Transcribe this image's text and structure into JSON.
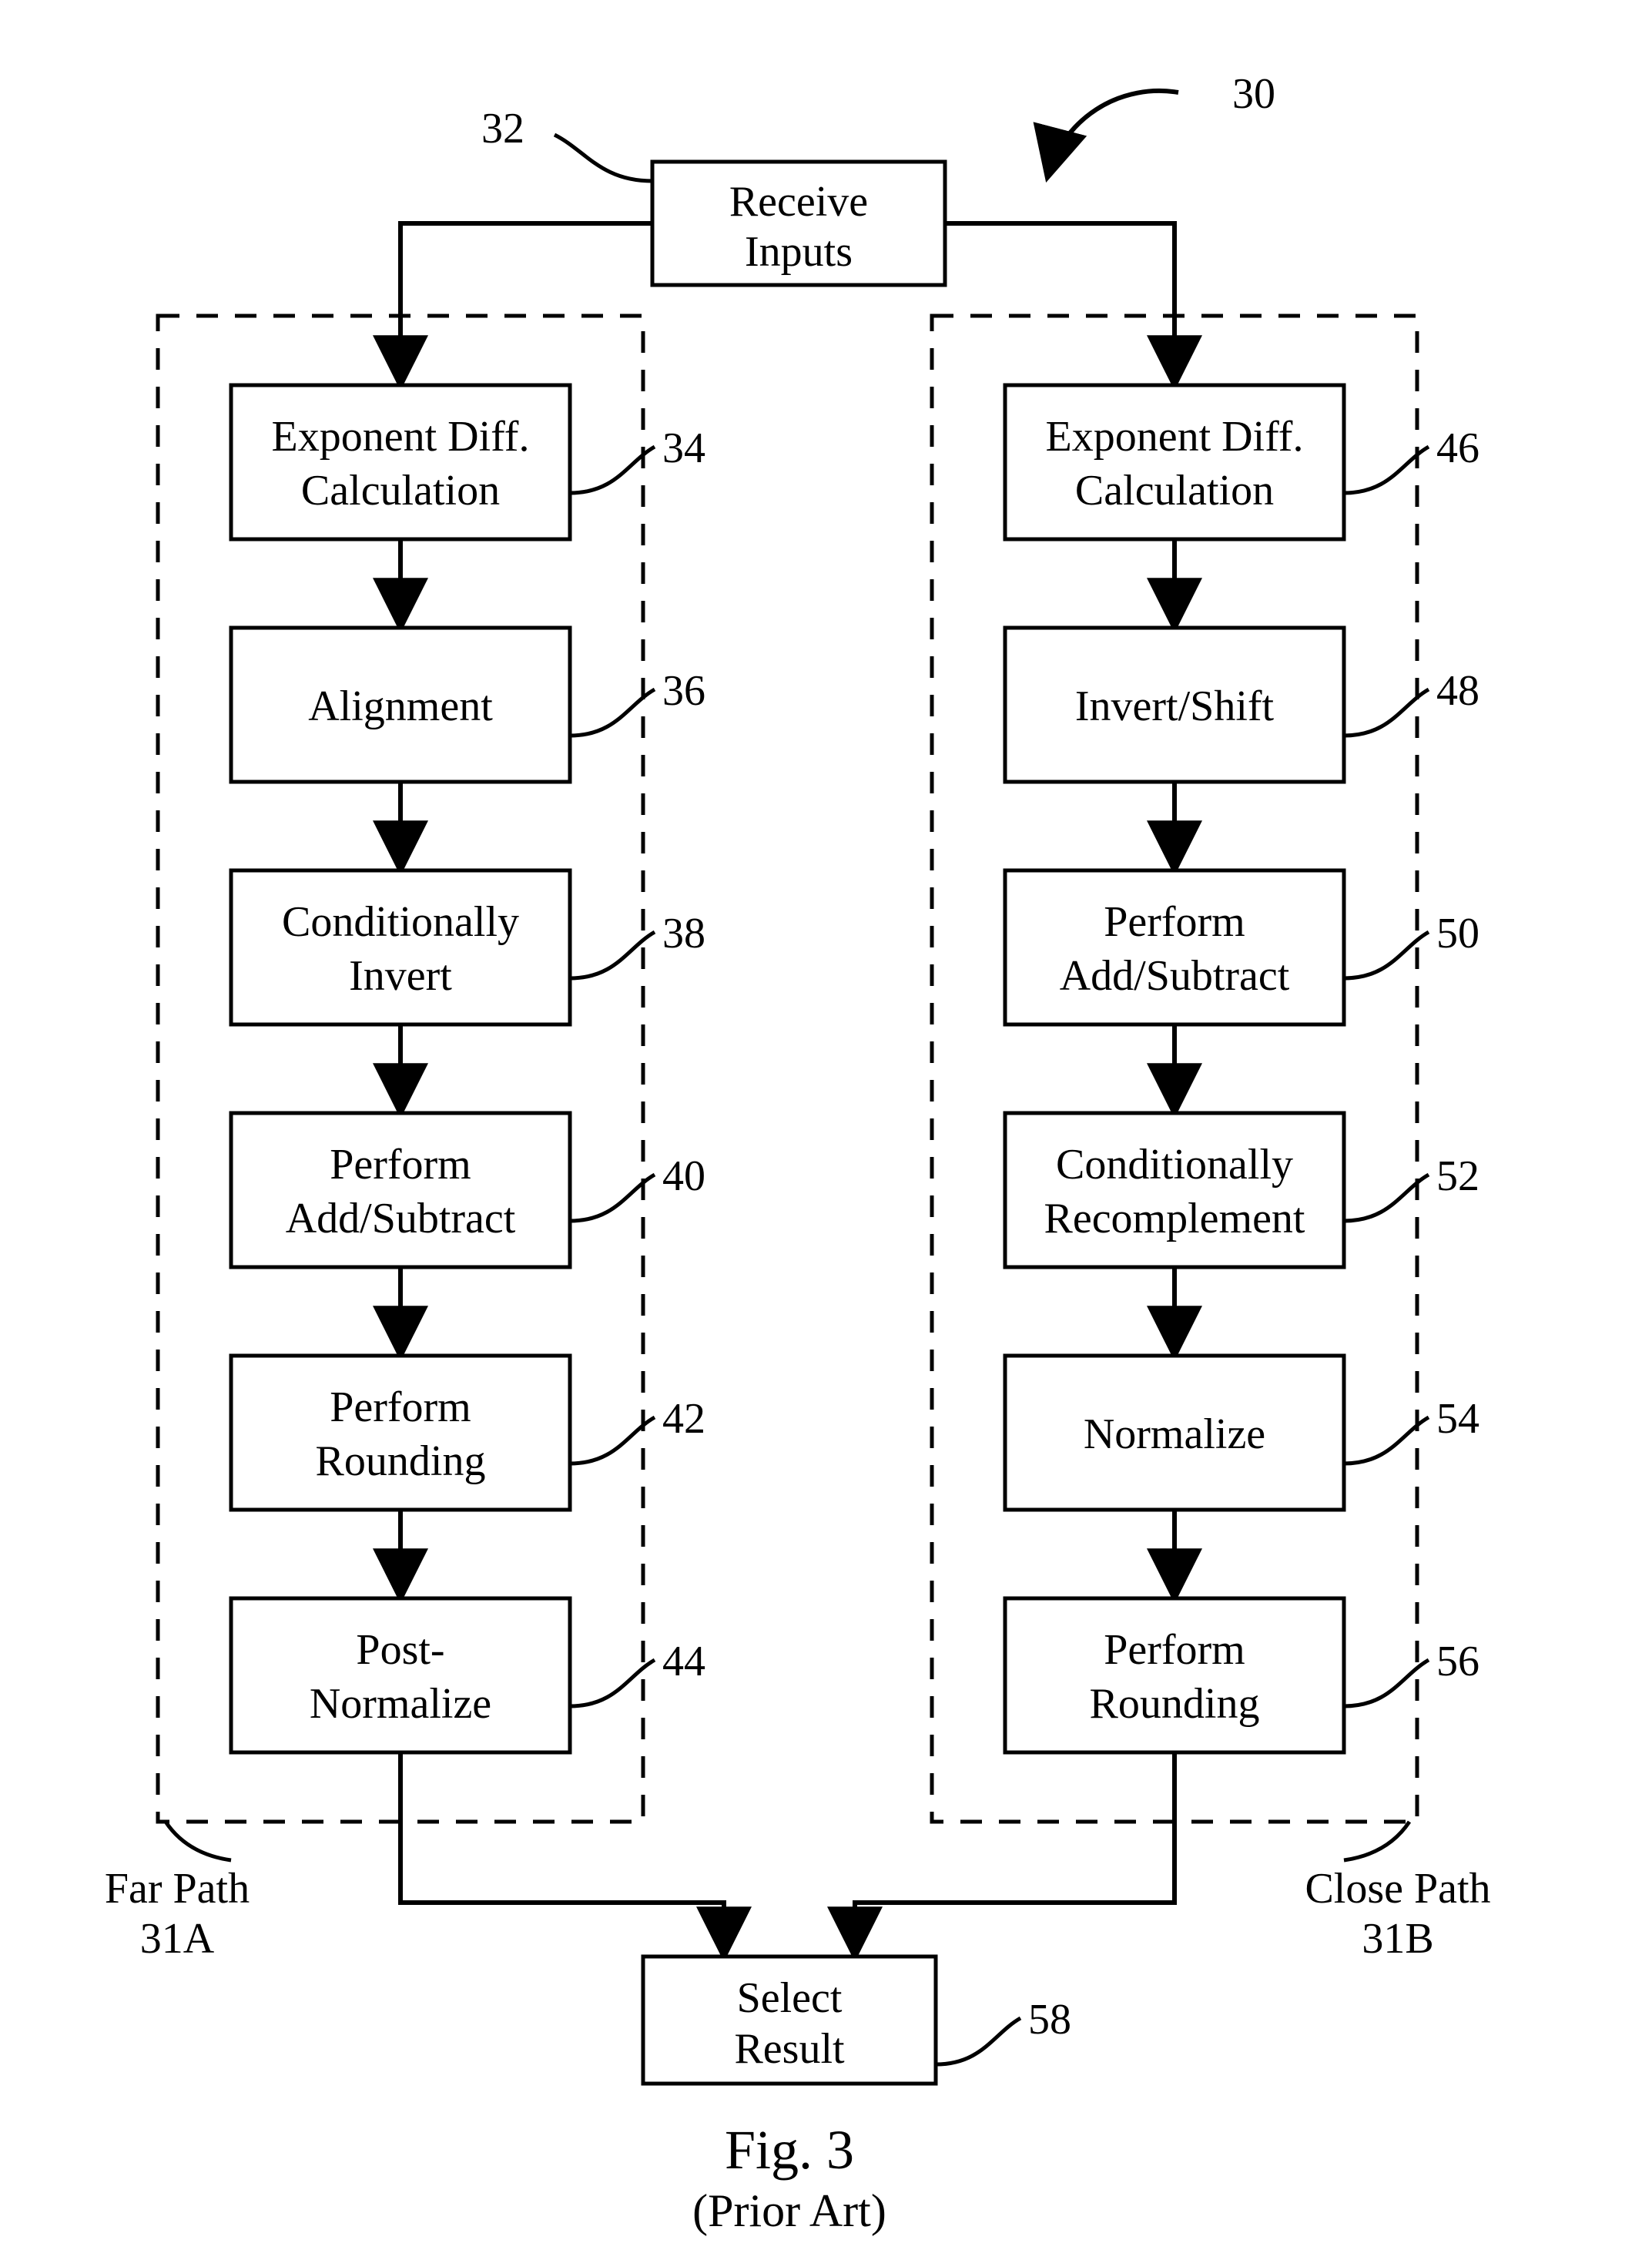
{
  "figure_label_line1": "Fig. 3",
  "figure_label_line2": "(Prior Art)",
  "ref_30": "30",
  "ref_32": "32",
  "start_box_line1": "Receive",
  "start_box_line2": "Inputs",
  "far_path": {
    "label_line1": "Far Path",
    "label_line2": "31A",
    "steps": [
      {
        "line1": "Exponent Diff.",
        "line2": "Calculation",
        "ref": "34"
      },
      {
        "line1": "Alignment",
        "line2": "",
        "ref": "36"
      },
      {
        "line1": "Conditionally",
        "line2": "Invert",
        "ref": "38"
      },
      {
        "line1": "Perform",
        "line2": "Add/Subtract",
        "ref": "40"
      },
      {
        "line1": "Perform",
        "line2": "Rounding",
        "ref": "42"
      },
      {
        "line1": "Post-",
        "line2": "Normalize",
        "ref": "44"
      }
    ]
  },
  "close_path": {
    "label_line1": "Close Path",
    "label_line2": "31B",
    "steps": [
      {
        "line1": "Exponent Diff.",
        "line2": "Calculation",
        "ref": "46"
      },
      {
        "line1": "Invert/Shift",
        "line2": "",
        "ref": "48"
      },
      {
        "line1": "Perform",
        "line2": "Add/Subtract",
        "ref": "50"
      },
      {
        "line1": "Conditionally",
        "line2": "Recomplement",
        "ref": "52"
      },
      {
        "line1": "Normalize",
        "line2": "",
        "ref": "54"
      },
      {
        "line1": "Perform",
        "line2": "Rounding",
        "ref": "56"
      }
    ]
  },
  "end_box_line1": "Select",
  "end_box_line2": "Result",
  "ref_58": "58"
}
